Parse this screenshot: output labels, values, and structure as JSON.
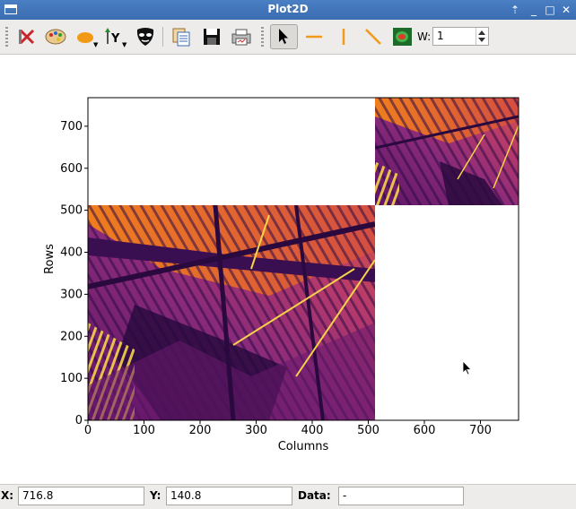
{
  "window": {
    "title": "Plot2D"
  },
  "toolbar": {
    "width_label": "W:",
    "width_value": "1"
  },
  "plot": {
    "xlabel": "Columns",
    "ylabel": "Rows",
    "x_ticks": [
      "0",
      "100",
      "200",
      "300",
      "400",
      "500",
      "600",
      "700"
    ],
    "y_ticks": [
      "0",
      "100",
      "200",
      "300",
      "400",
      "500",
      "600",
      "700"
    ],
    "colormap": "inferno"
  },
  "status": {
    "x_label": "X:",
    "x_value": "716.8",
    "y_label": "Y:",
    "y_value": "140.8",
    "data_label": "Data:",
    "data_value": "-"
  }
}
